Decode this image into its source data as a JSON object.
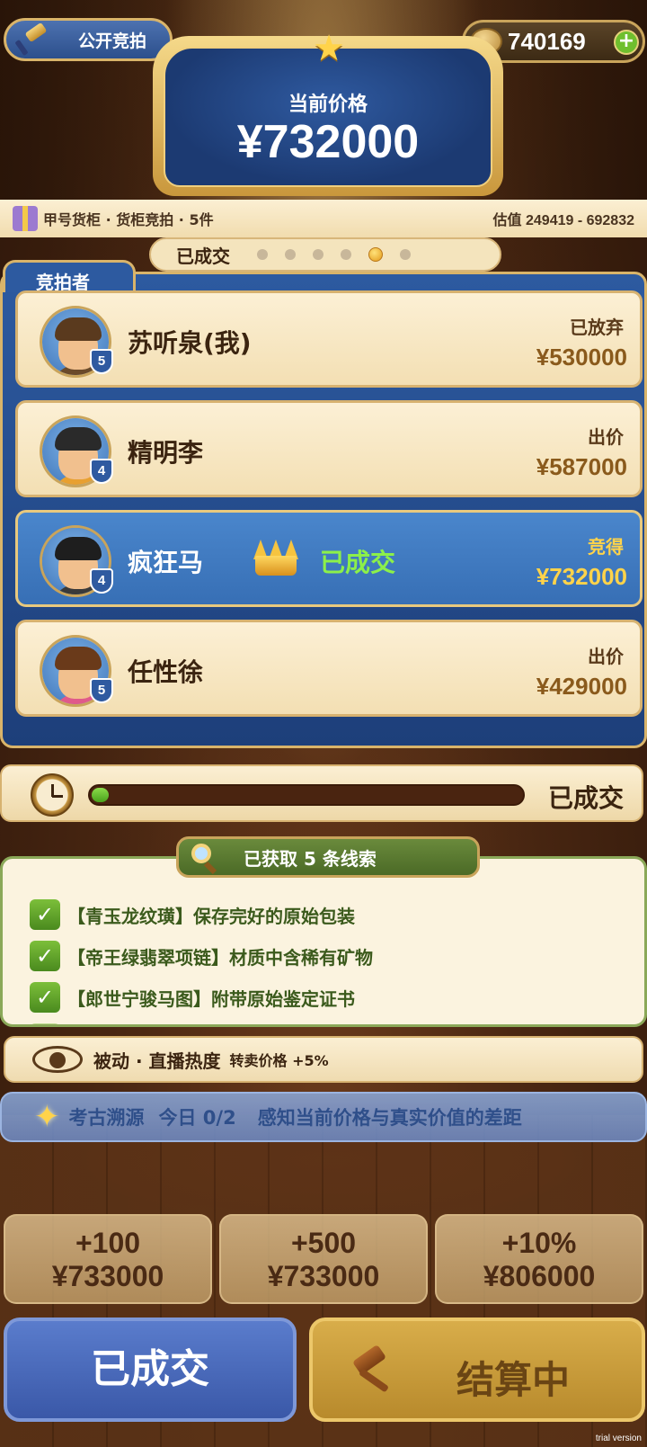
{
  "header": {
    "public_auction_label": "公开竞拍",
    "coins": "740169",
    "current_price_label": "当前价格",
    "current_price": "¥732000"
  },
  "info": {
    "left": "甲号货柜 · 货柜竞拍 · 5件",
    "right": "估值 249419 - 692832"
  },
  "status_pill": {
    "label": "已成交",
    "dots_total": 6,
    "active_dot": 5
  },
  "bidders": {
    "tab_label": "竞拍者",
    "list": [
      {
        "name": "苏听泉(我)",
        "level": "5",
        "status": "已放弃",
        "bid": "¥530000",
        "winner": false
      },
      {
        "name": "精明李",
        "level": "4",
        "status": "出价",
        "bid": "¥587000",
        "winner": false
      },
      {
        "name": "疯狂马",
        "level": "4",
        "status": "竞得",
        "bid": "¥732000",
        "winner": true,
        "win_text": "已成交"
      },
      {
        "name": "任性徐",
        "level": "5",
        "status": "出价",
        "bid": "¥429000",
        "winner": false
      }
    ]
  },
  "timer": {
    "progress": 0.04,
    "label": "已成交"
  },
  "clues": {
    "header": "已获取 5 条线索",
    "items": [
      "【青玉龙纹璜】保存完好的原始包装",
      "【帝王绿翡翠项链】材质中含稀有矿物",
      "【郎世宁骏马图】附带原始鉴定证书"
    ]
  },
  "passive": {
    "label": "被动 · 直播热度",
    "effect": "转卖价格 +5%"
  },
  "archaeology": {
    "title": "考古溯源",
    "count": "今日 0/2",
    "desc": "感知当前价格与真实价值的差距"
  },
  "quick_bids": [
    {
      "increment": "+100",
      "price": "¥733000"
    },
    {
      "increment": "+500",
      "price": "¥733000"
    },
    {
      "increment": "+10%",
      "price": "¥806000"
    }
  ],
  "buttons": {
    "done": "已成交",
    "settle": "结算中"
  },
  "watermark": "trial version",
  "colors": {
    "panel_blue": "#2d5aa0",
    "gold": "#d9b46a",
    "win_green": "#8cf04a",
    "price_gold": "#ffd34a"
  }
}
